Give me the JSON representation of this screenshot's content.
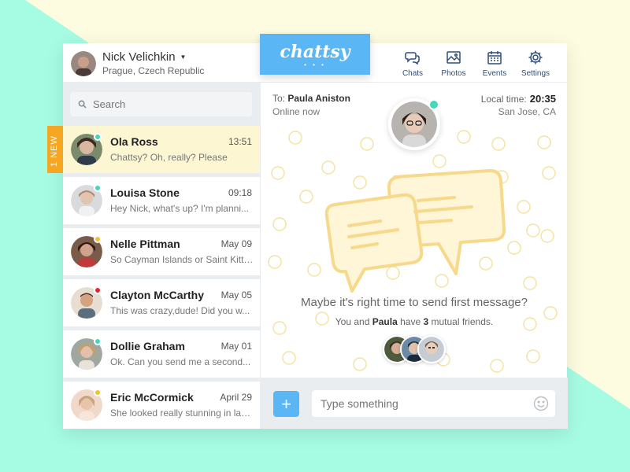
{
  "colors": {
    "accent": "#5bb6f5",
    "mint_bg": "#a6fbe3",
    "cream_bg": "#fdfbe0",
    "new_badge": "#f5a623",
    "online": "#44d8b8",
    "away": "#f5c030",
    "busy": "#e8232d",
    "active_row": "#fdf6d3"
  },
  "user": {
    "name": "Nick Velichkin",
    "location": "Prague, Czech Republic"
  },
  "logo": {
    "text": "chattsy",
    "dots": "• • •"
  },
  "nav": [
    {
      "label": "Chats",
      "icon": "chats-icon"
    },
    {
      "label": "Photos",
      "icon": "photos-icon"
    },
    {
      "label": "Events",
      "icon": "events-icon"
    },
    {
      "label": "Settings",
      "icon": "settings-icon"
    }
  ],
  "search": {
    "placeholder": "Search"
  },
  "new_badge": "1 NEW",
  "chats": [
    {
      "name": "Ola Ross",
      "time": "13:51",
      "preview": "Chattsy? Oh, really? Please",
      "status": "online"
    },
    {
      "name": "Louisa Stone",
      "time": "09:18",
      "preview": "Hey Nick, what's up? I'm planni...",
      "status": "online"
    },
    {
      "name": "Nelle Pittman",
      "time": "May 09",
      "preview": "So Cayman Islands or Saint Kitts?",
      "status": "away"
    },
    {
      "name": "Clayton McCarthy",
      "time": "May 05",
      "preview": "This was crazy,dude! Did you w...",
      "status": "busy"
    },
    {
      "name": "Dollie Graham",
      "time": "May 01",
      "preview": "Ok. Can you send me a second...",
      "status": "online"
    },
    {
      "name": "Eric McCormick",
      "time": "April 29",
      "preview": "She looked really stunning in last...",
      "status": "away"
    }
  ],
  "conversation": {
    "to_label": "To:",
    "to_name": "Paula Aniston",
    "online_status": "Online now",
    "local_time_label": "Local time:",
    "local_time": "20:35",
    "location": "San Jose, CA",
    "empty_title": "Maybe it's right time to send first message?",
    "sub_prefix": "You and",
    "sub_name": "Paula",
    "sub_middle": "have",
    "sub_count": "3",
    "sub_suffix": "mutual friends."
  },
  "composer": {
    "add_label": "+",
    "placeholder": "Type something"
  }
}
